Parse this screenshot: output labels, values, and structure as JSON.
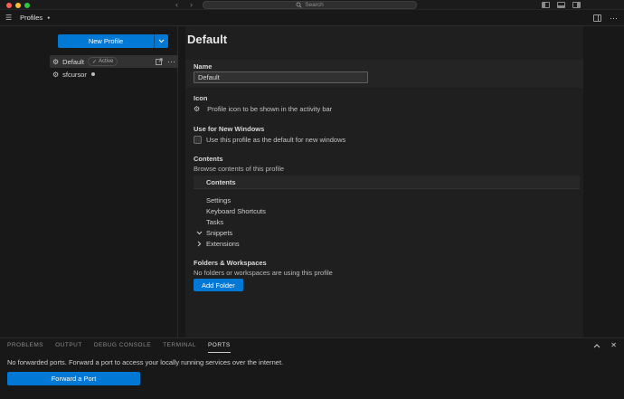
{
  "colors": {
    "accent": "#0078d4",
    "editor_bg": "#1f1f1f",
    "shell_bg": "#181818",
    "border": "#2b2b2b",
    "selected_row_bg": "#323233",
    "traffic_red": "#ff5f57",
    "traffic_yellow": "#febc2e",
    "traffic_green": "#28c840"
  },
  "icons": {
    "menu": "☰",
    "gear": "⚙",
    "more": "⋯",
    "dirty_dot": "●",
    "check": "✓",
    "close": "✕",
    "back": "‹",
    "forward": "›"
  },
  "titlebar": {
    "search_placeholder": "Search"
  },
  "tabbar": {
    "tab_label": "Profiles"
  },
  "sidebar": {
    "new_profile_label": "New Profile",
    "profiles": [
      {
        "name": "Default",
        "badge_label": "Active",
        "selected": true
      },
      {
        "name": "sfcursor",
        "selected": false
      }
    ]
  },
  "details": {
    "title": "Default",
    "name_section": {
      "label": "Name",
      "value": "Default"
    },
    "icon_section": {
      "label": "Icon",
      "description": "Profile icon to be shown in the activity bar"
    },
    "windows_section": {
      "label": "Use for New Windows",
      "checkbox_label": "Use this profile as the default for new windows",
      "checked": false
    },
    "contents_section": {
      "label": "Contents",
      "description": "Browse contents of this profile",
      "header": "Contents",
      "rows": [
        {
          "label": "Settings",
          "chevron": "none"
        },
        {
          "label": "Keyboard Shortcuts",
          "chevron": "none"
        },
        {
          "label": "Tasks",
          "chevron": "none"
        },
        {
          "label": "Snippets",
          "chevron": "down"
        },
        {
          "label": "Extensions",
          "chevron": "right"
        }
      ]
    },
    "folders_section": {
      "label": "Folders & Workspaces",
      "description": "No folders or workspaces are using this profile",
      "button_label": "Add Folder"
    }
  },
  "panel": {
    "tabs": [
      {
        "label": "PROBLEMS",
        "active": false
      },
      {
        "label": "OUTPUT",
        "active": false
      },
      {
        "label": "DEBUG CONSOLE",
        "active": false
      },
      {
        "label": "TERMINAL",
        "active": false
      },
      {
        "label": "PORTS",
        "active": true
      }
    ],
    "message": "No forwarded ports. Forward a port to access your locally running services over the internet.",
    "forward_button_label": "Forward a Port"
  }
}
